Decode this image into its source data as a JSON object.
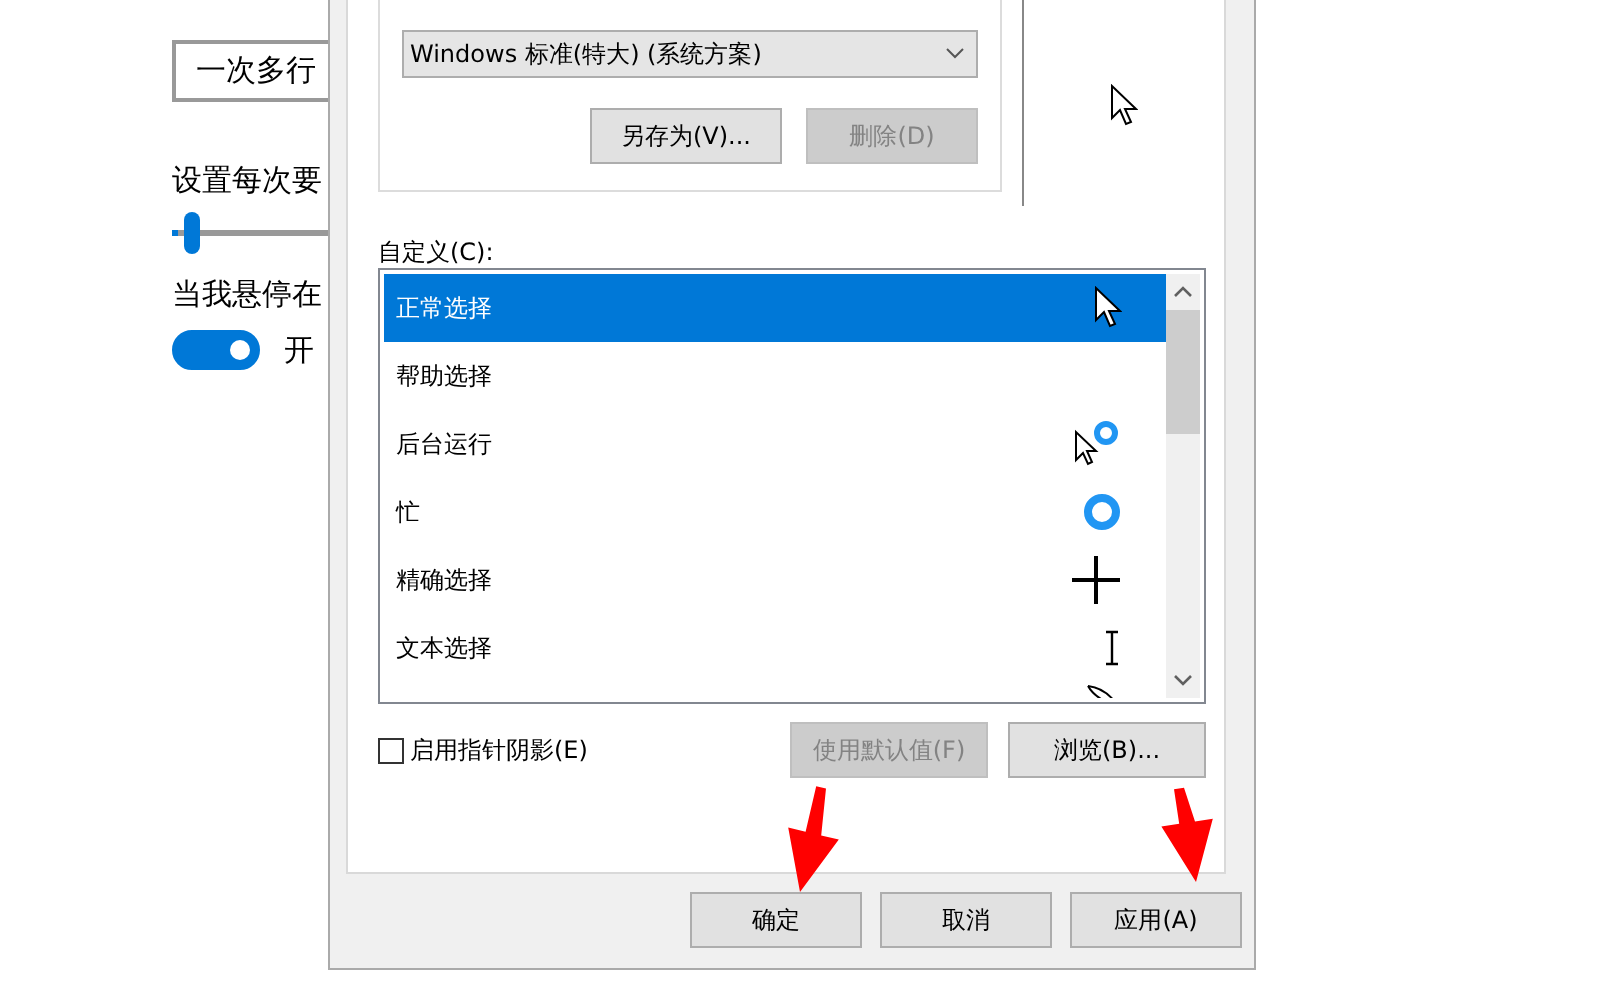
{
  "settings_page": {
    "scroll_dropdown": {
      "value": "一次多行"
    },
    "lines_label": "设置每次要",
    "lines_slider": {
      "level": 0.03
    },
    "hover_label": "当我悬停在",
    "hover_toggle": {
      "on": true,
      "text": "开"
    }
  },
  "dialog": {
    "scheme_dropdown": {
      "value": "Windows 标准(特大) (系统方案)"
    },
    "scheme_buttons": [
      {
        "label": "另存为(V)...",
        "disabled": false
      },
      {
        "label": "删除(D)",
        "disabled": true
      }
    ],
    "customize_label": "自定义(C):",
    "cursors": [
      {
        "name": "正常选择",
        "kind": "arrow",
        "selected": true
      },
      {
        "name": "帮助选择",
        "kind": "none",
        "selected": false
      },
      {
        "name": "后台运行",
        "kind": "working",
        "selected": false
      },
      {
        "name": "忙",
        "kind": "busy",
        "selected": false
      },
      {
        "name": "精确选择",
        "kind": "cross",
        "selected": false
      },
      {
        "name": "文本选择",
        "kind": "ibeam",
        "selected": false
      },
      {
        "kind": "pen",
        "selected": false
      }
    ],
    "shadow_checkbox": {
      "label": "启用指针阴影(E)",
      "checked": false
    },
    "list_buttons": [
      {
        "label": "使用默认值(F)",
        "disabled": true
      },
      {
        "label": "浏览(B)...",
        "disabled": false
      }
    ],
    "footer_buttons": [
      {
        "label": "确定"
      },
      {
        "label": "取消"
      },
      {
        "label": "应用(A)"
      }
    ]
  },
  "annotations": [
    {
      "kind": "arrow"
    },
    {
      "kind": "arrow"
    }
  ]
}
